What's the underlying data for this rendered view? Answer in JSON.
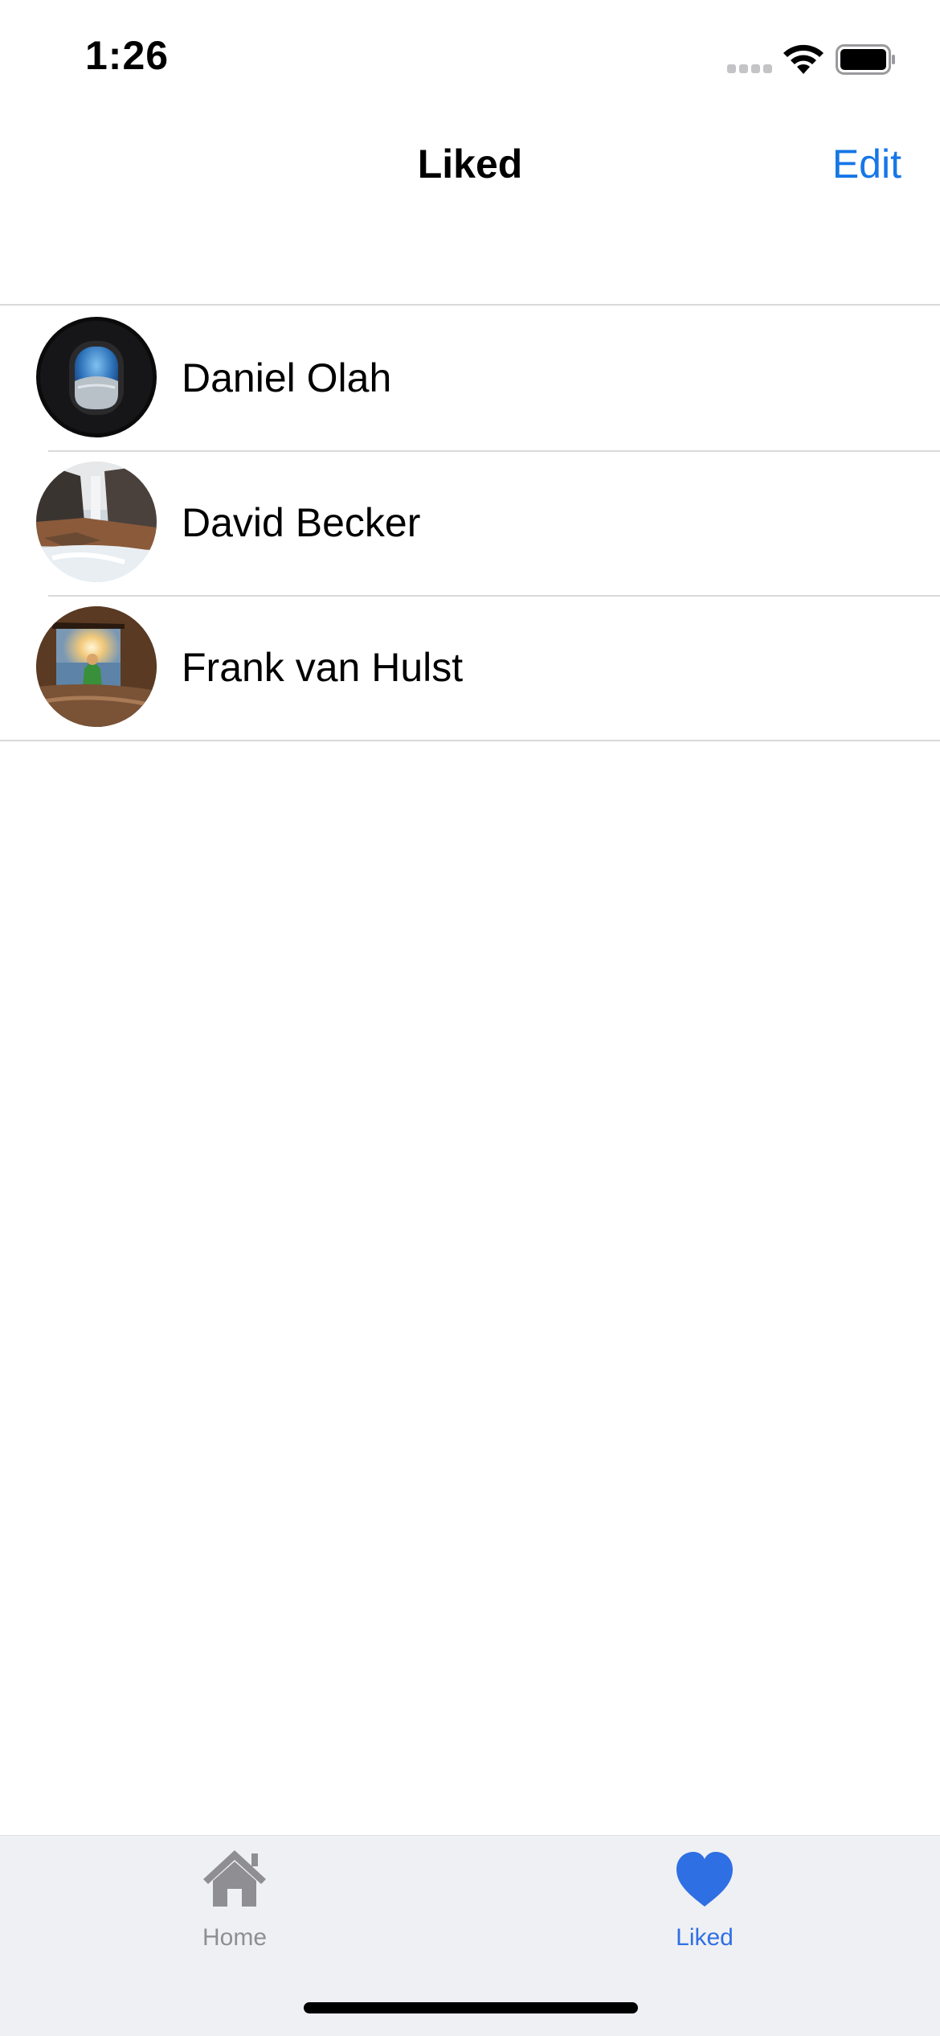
{
  "status_bar": {
    "time": "1:26"
  },
  "nav": {
    "title": "Liked",
    "edit_label": "Edit"
  },
  "list": {
    "items": [
      {
        "name": "Daniel Olah"
      },
      {
        "name": "David Becker"
      },
      {
        "name": "Frank van Hulst"
      }
    ]
  },
  "tab_bar": {
    "tabs": [
      {
        "label": "Home",
        "icon": "house-icon",
        "selected": false
      },
      {
        "label": "Liked",
        "icon": "heart-icon",
        "selected": true
      }
    ]
  },
  "colors": {
    "accent": "#1677e6",
    "tab_selected": "#2f6fe4",
    "tab_unselected": "#8e8e93",
    "tab_bar_bg": "#eff0f4"
  }
}
